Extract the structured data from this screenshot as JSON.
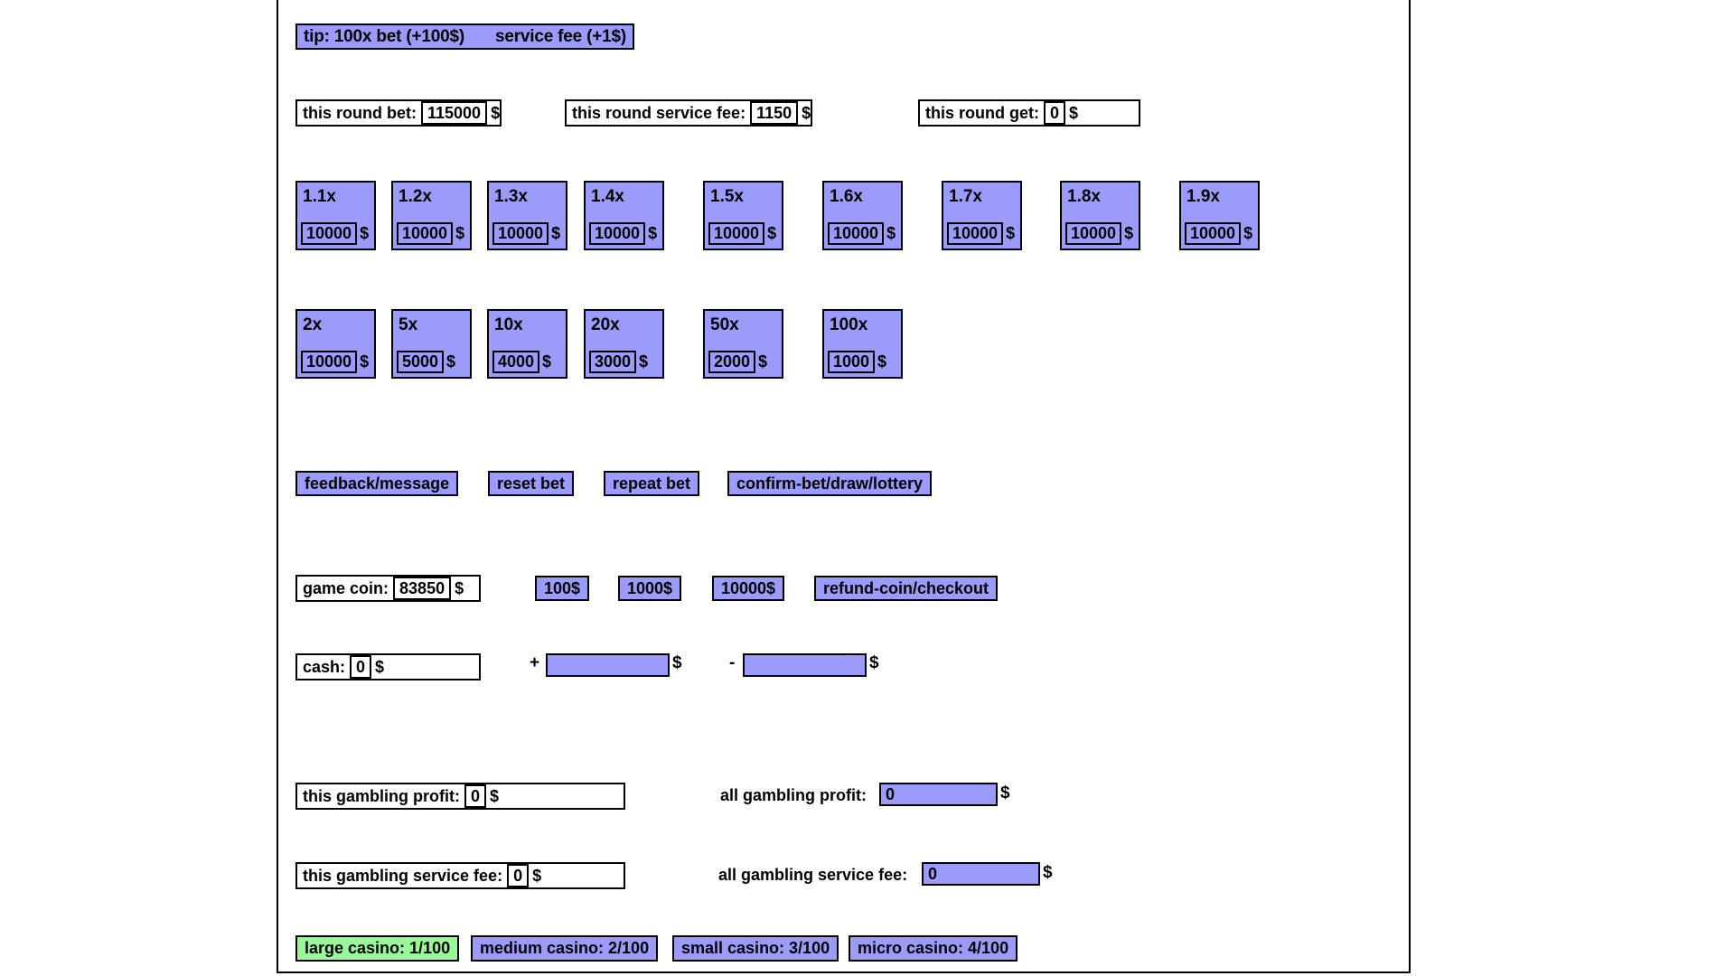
{
  "tip": {
    "bet_text": "tip: 100x bet (+100$)",
    "fee_text": "service fee (+1$)"
  },
  "round": {
    "bet_label": "this round bet:",
    "bet_value": "115000",
    "bet_currency": "$",
    "fee_label": "this round service fee:",
    "fee_value": "1150",
    "fee_currency": "$",
    "get_label": "this round get:",
    "get_value": "0",
    "get_currency": "$"
  },
  "multipliers_row1": [
    {
      "mult": "1.1x",
      "amount": "10000",
      "currency": "$"
    },
    {
      "mult": "1.2x",
      "amount": "10000",
      "currency": "$"
    },
    {
      "mult": "1.3x",
      "amount": "10000",
      "currency": "$"
    },
    {
      "mult": "1.4x",
      "amount": "10000",
      "currency": "$"
    },
    {
      "mult": "1.5x",
      "amount": "10000",
      "currency": "$"
    },
    {
      "mult": "1.6x",
      "amount": "10000",
      "currency": "$"
    },
    {
      "mult": "1.7x",
      "amount": "10000",
      "currency": "$"
    },
    {
      "mult": "1.8x",
      "amount": "10000",
      "currency": "$"
    },
    {
      "mult": "1.9x",
      "amount": "10000",
      "currency": "$"
    }
  ],
  "multipliers_row2": [
    {
      "mult": "2x",
      "amount": "10000",
      "currency": "$"
    },
    {
      "mult": "5x",
      "amount": "5000",
      "currency": "$"
    },
    {
      "mult": "10x",
      "amount": "4000",
      "currency": "$"
    },
    {
      "mult": "20x",
      "amount": "3000",
      "currency": "$"
    },
    {
      "mult": "50x",
      "amount": "2000",
      "currency": "$"
    },
    {
      "mult": "100x",
      "amount": "1000",
      "currency": "$"
    }
  ],
  "actions": {
    "feedback": "feedback/message",
    "reset": "reset bet",
    "repeat": "repeat bet",
    "confirm": "confirm-bet/draw/lottery"
  },
  "coin": {
    "label": "game coin:",
    "value": "83850",
    "currency": "$",
    "buy_100": "100$",
    "buy_1000": "1000$",
    "buy_10000": "10000$",
    "refund": "refund-coin/checkout"
  },
  "cash": {
    "label": "cash:",
    "value": "0",
    "currency": "$",
    "plus_sign": "+",
    "plus_value": "",
    "plus_currency": "$",
    "minus_sign": "-",
    "minus_value": "",
    "minus_currency": "$"
  },
  "stats": {
    "this_profit_label": "this gambling profit:",
    "this_profit_value": "0",
    "this_profit_currency": "$",
    "all_profit_label": "all gambling profit:",
    "all_profit_value": "0",
    "all_profit_currency": "$",
    "this_fee_label": "this gambling service fee:",
    "this_fee_value": "0",
    "this_fee_currency": "$",
    "all_fee_label": "all gambling service fee:",
    "all_fee_value": "0",
    "all_fee_currency": "$"
  },
  "casinos": [
    {
      "label": "large casino: 1/100",
      "active": true
    },
    {
      "label": "medium casino: 2/100",
      "active": false
    },
    {
      "label": "small casino: 3/100",
      "active": false
    },
    {
      "label": "micro casino: 4/100",
      "active": false
    }
  ],
  "colors": {
    "accent_blue": "#9b9bfb",
    "active_green": "#99f999",
    "border": "#000000",
    "page_bg": "#ffffff"
  }
}
